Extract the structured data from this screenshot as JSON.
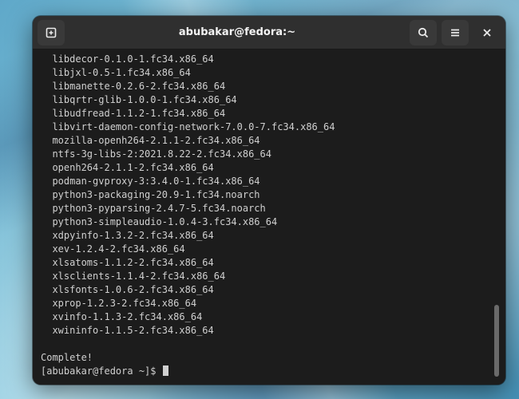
{
  "window": {
    "title": "abubakar@fedora:~"
  },
  "terminal": {
    "packages": [
      "libdecor-0.1.0-1.fc34.x86_64",
      "libjxl-0.5-1.fc34.x86_64",
      "libmanette-0.2.6-2.fc34.x86_64",
      "libqrtr-glib-1.0.0-1.fc34.x86_64",
      "libudfread-1.1.2-1.fc34.x86_64",
      "libvirt-daemon-config-network-7.0.0-7.fc34.x86_64",
      "mozilla-openh264-2.1.1-2.fc34.x86_64",
      "ntfs-3g-libs-2:2021.8.22-2.fc34.x86_64",
      "openh264-2.1.1-2.fc34.x86_64",
      "podman-gvproxy-3:3.4.0-1.fc34.x86_64",
      "python3-packaging-20.9-1.fc34.noarch",
      "python3-pyparsing-2.4.7-5.fc34.noarch",
      "python3-simpleaudio-1.0.4-3.fc34.x86_64",
      "xdpyinfo-1.3.2-2.fc34.x86_64",
      "xev-1.2.4-2.fc34.x86_64",
      "xlsatoms-1.1.2-2.fc34.x86_64",
      "xlsclients-1.1.4-2.fc34.x86_64",
      "xlsfonts-1.0.6-2.fc34.x86_64",
      "xprop-1.2.3-2.fc34.x86_64",
      "xvinfo-1.1.3-2.fc34.x86_64",
      "xwininfo-1.1.5-2.fc34.x86_64"
    ],
    "complete_line": "Complete!",
    "prompt": "[abubakar@fedora ~]$"
  }
}
